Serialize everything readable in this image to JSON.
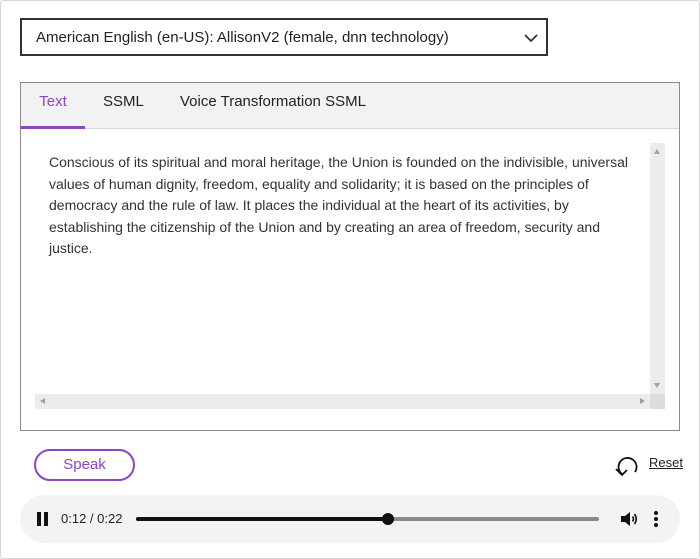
{
  "voice_select": {
    "selected": "American English (en-US): AllisonV2 (female, dnn technology)",
    "icon": "chevron-down-icon"
  },
  "tabs": [
    {
      "label": "Text",
      "active": true
    },
    {
      "label": "SSML",
      "active": false
    },
    {
      "label": "Voice Transformation SSML",
      "active": false
    }
  ],
  "text_input": {
    "value": "Conscious of its spiritual and moral heritage, the Union is founded on the indivisible, universal values of human dignity, freedom, equality and solidarity; it is based on the principles of democracy and the rule of law. It places the individual at the heart of its activities, by establishing the citizenship of the Union and by creating an area of freedom, security and justice."
  },
  "actions": {
    "speak_label": "Speak",
    "reset_label": "Reset",
    "reset_icon": "undo-arrow-icon"
  },
  "audio_player": {
    "time_display": "0:12 / 0:22",
    "progress_fraction": 0.545,
    "state": "playing",
    "icons": [
      "pause-icon",
      "volume-icon",
      "more-options-icon"
    ]
  },
  "colors": {
    "accent": "#8e44c7",
    "player_bg": "#f1f3f4"
  }
}
